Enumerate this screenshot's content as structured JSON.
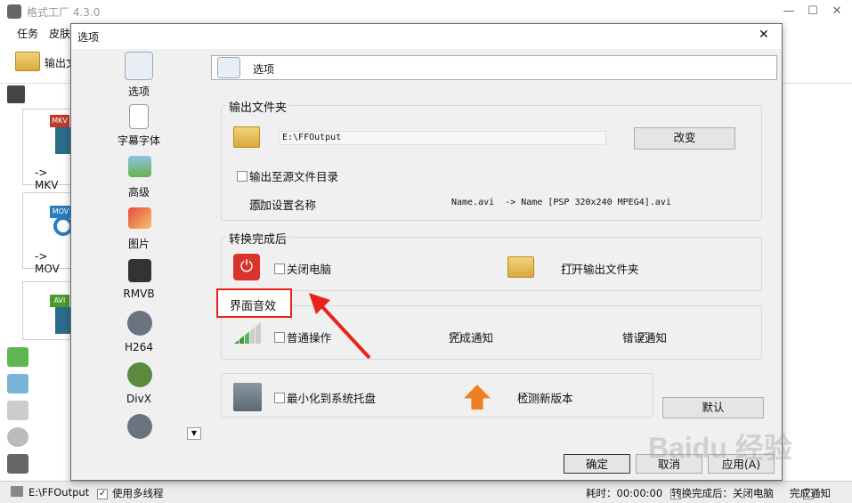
{
  "app": {
    "title": "格式工厂 4.3.0",
    "menu": [
      "任务",
      "皮肤"
    ],
    "toolbar_output": "输出文",
    "items": [
      {
        "label": "-> MKV",
        "badge": "MKV"
      },
      {
        "label": "-> MOV",
        "badge": "MOV"
      },
      {
        "badge": "AVI"
      }
    ]
  },
  "status": {
    "path": "E:\\FFOutput",
    "multithread": "使用多线程",
    "elapsed": "耗时：00:00:00",
    "after": "转换完成后：关闭电脑",
    "notify": "完成通知"
  },
  "dialog": {
    "title": "选项",
    "nav": [
      {
        "label": "选项",
        "icon": "options-icon"
      },
      {
        "label": "字幕字体",
        "icon": "subtitle-font-icon"
      },
      {
        "label": "高级",
        "icon": "advanced-icon"
      },
      {
        "label": "图片",
        "icon": "picture-icon"
      },
      {
        "label": "RMVB",
        "icon": "rmvb-icon"
      },
      {
        "label": "H264",
        "icon": "h264-icon"
      },
      {
        "label": "DivX",
        "icon": "divx-icon"
      }
    ],
    "header": "选项",
    "output_group": {
      "title": "输出文件夹",
      "path": "E:\\FFOutput",
      "change_button": "改变",
      "to_source": "输出至源文件目录",
      "add_setting_name": "添加设置名称",
      "example": "Name.avi  -> Name [PSP 320x240 MPEG4].avi"
    },
    "after_group": {
      "title": "转换完成后",
      "shutdown": "关闭电脑",
      "open_folder": "打开输出文件夹"
    },
    "sound_group": {
      "title": "界面音效",
      "normal": "普通操作",
      "done": "完成通知",
      "error": "错误通知"
    },
    "misc": {
      "minimize_tray": "最小化到系统托盘",
      "check_update": "检测新版本"
    },
    "default_button": "默认",
    "ok_button": "确定",
    "cancel_button": "取消",
    "apply_button": "应用(A)"
  },
  "watermark": "Baidu 经验"
}
